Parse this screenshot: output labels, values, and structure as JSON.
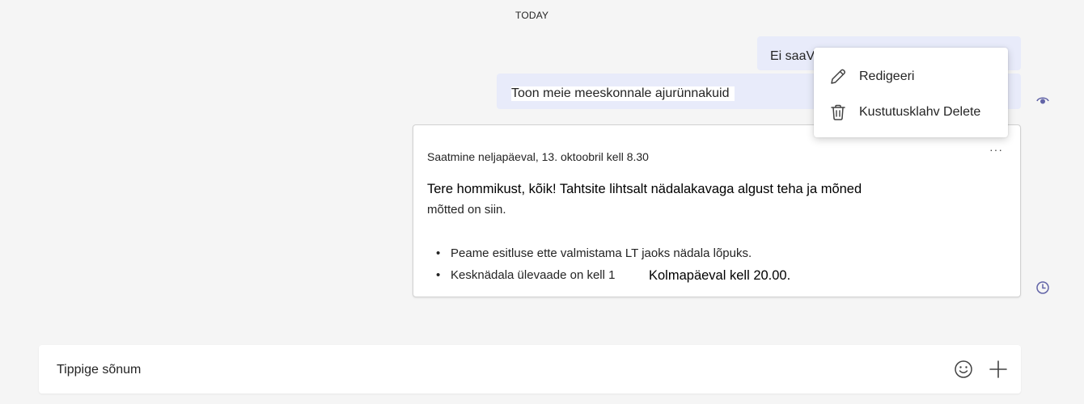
{
  "chat": {
    "date_divider": "TODAY",
    "messages": [
      {
        "text": "Ei saaV"
      },
      {
        "text": "Toon meie meeskonnale ajurünnakuid"
      }
    ],
    "card": {
      "meta": "Saatmine neljapäeval, 13. oktoobril kell 8.30",
      "body_line1": "Tere hommikust, kõik! Tahtsite lihtsalt nädalakavaga algust teha ja mõned",
      "body_line2": "mõtted on siin.",
      "bullets": [
        "Peame esitluse ette valmistama LT jaoks nädala lõpuks.",
        "Kesknädala ülevaade on kell 1"
      ],
      "bullet2_extra": "Kolmapäeval kell 20.00.",
      "more_label": "···"
    }
  },
  "context_menu": {
    "items": [
      {
        "label": "Redigeeri",
        "icon": "pencil-icon"
      },
      {
        "label": "Kustutusklahv Delete",
        "icon": "trash-icon"
      }
    ]
  },
  "composer": {
    "placeholder": "Tippige sõnum",
    "emoji_icon": "emoji-icon",
    "plus_icon": "plus-icon"
  },
  "colors": {
    "background": "#f5f5f5",
    "sent_bubble": "#e8ebfa",
    "accent": "#6264a7"
  }
}
